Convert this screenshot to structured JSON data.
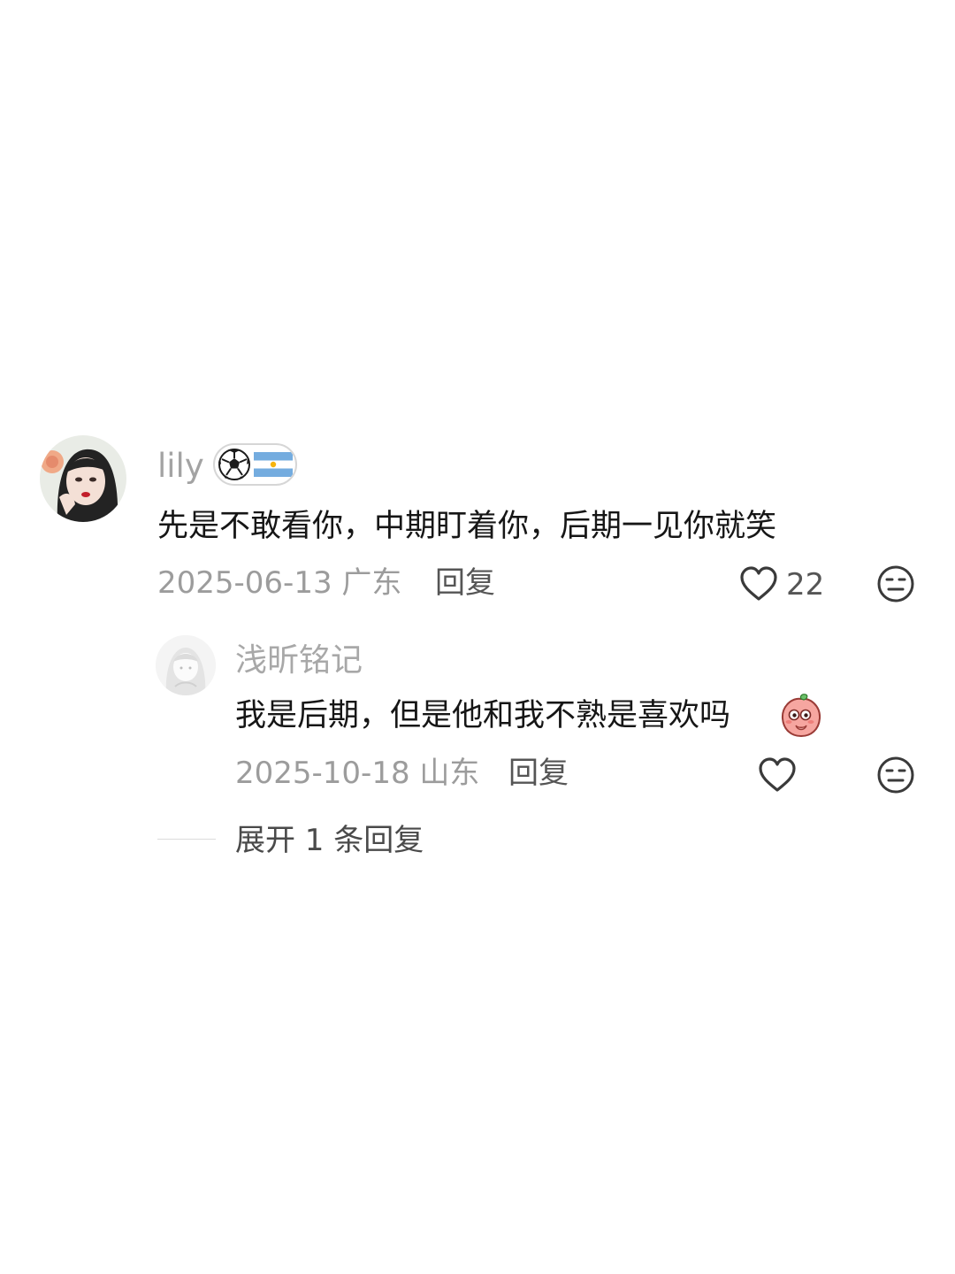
{
  "comment": {
    "username": "lily",
    "badge_icons": [
      "soccer-ball-icon",
      "argentina-flag-icon"
    ],
    "text": "先是不敢看你，中期盯着你，后期一见你就笑",
    "date": "2025-06-13",
    "location": "广东",
    "reply_label": "回复",
    "like_count": "22",
    "like_icon": "heart-outline-icon",
    "dislike_icon": "meh-face-icon"
  },
  "reply": {
    "username": "浅昕铭记",
    "text": "我是后期，但是他和我不熟是喜欢吗",
    "sticker_icon": "peach-shy-sticker",
    "date": "2025-10-18",
    "location": "山东",
    "reply_label": "回复",
    "like_icon": "heart-outline-icon",
    "dislike_icon": "meh-face-icon"
  },
  "expand": {
    "label": "展开 1 条回复"
  },
  "colors": {
    "background": "#ffffff",
    "text_primary": "#161616",
    "text_secondary": "#9c9c9c",
    "action_text": "#555555"
  }
}
